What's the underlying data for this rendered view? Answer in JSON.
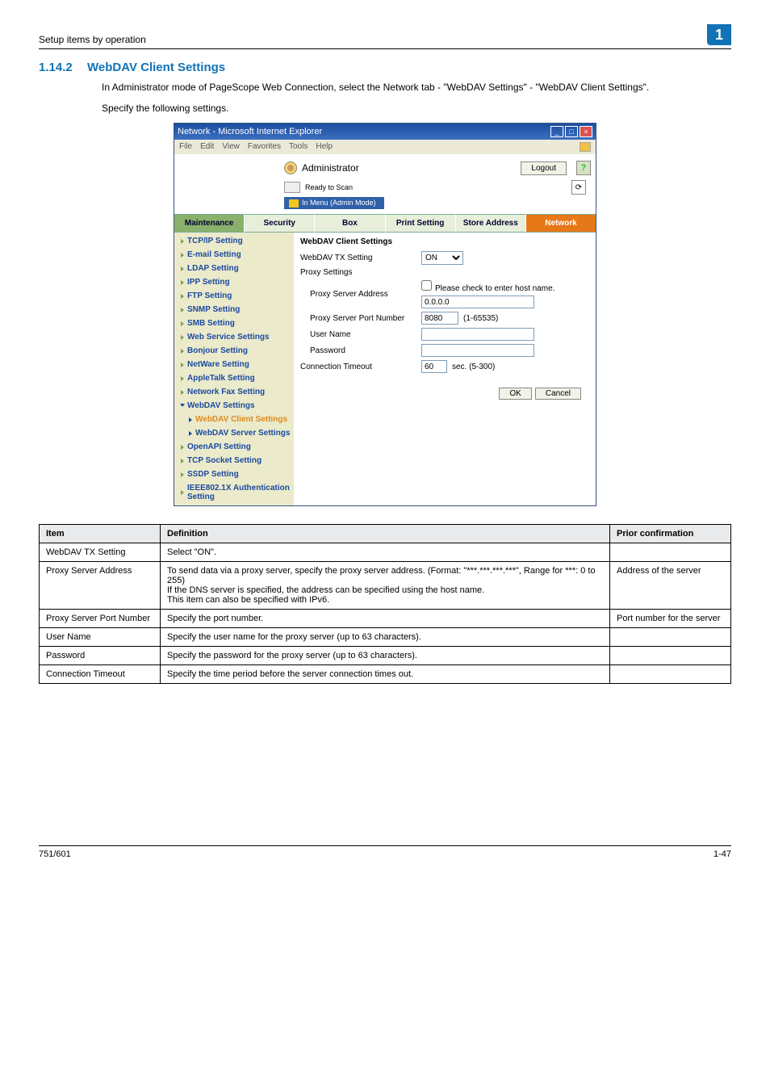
{
  "header": {
    "left": "Setup items by operation",
    "badge": "1"
  },
  "section": {
    "num": "1.14.2",
    "title": "WebDAV Client Settings",
    "p1": "In Administrator mode of PageScope Web Connection, select the Network tab - \"WebDAV Settings\" - \"WebDAV Client Settings\".",
    "p2": "Specify the following settings."
  },
  "window": {
    "title": "Network - Microsoft Internet Explorer",
    "minimize": "_",
    "restore": "□",
    "close": "×",
    "menus": [
      "File",
      "Edit",
      "View",
      "Favorites",
      "Tools",
      "Help"
    ],
    "admin_label": "Administrator",
    "logout": "Logout",
    "help": "?",
    "ready": "Ready to Scan",
    "ribbon": "In Menu (Admin Mode)",
    "refresh": "⟳",
    "tabs": {
      "maint": "Maintenance",
      "security": "Security",
      "box": "Box",
      "print": "Print Setting",
      "store": "Store Address",
      "network": "Network"
    },
    "side": {
      "items": [
        "TCP/IP Setting",
        "E-mail Setting",
        "LDAP Setting",
        "IPP Setting",
        "FTP Setting",
        "SNMP Setting",
        "SMB Setting",
        "Web Service Settings",
        "Bonjour Setting",
        "NetWare Setting",
        "AppleTalk Setting",
        "Network Fax Setting"
      ],
      "webdav_head": "WebDAV Settings",
      "webdav_client": "WebDAV Client Settings",
      "webdav_server": "WebDAV Server Settings",
      "rest": [
        "OpenAPI Setting",
        "TCP Socket Setting",
        "SSDP Setting",
        "IEEE802.1X Authentication Setting"
      ]
    },
    "form": {
      "heading": "WebDAV Client Settings",
      "tx_label": "WebDAV TX Setting",
      "tx_value": "ON",
      "proxy_section": "Proxy Settings",
      "addr_label": "Proxy Server Address",
      "addr_check": "Please check to enter host name.",
      "addr_value": "0.0.0.0",
      "port_label": "Proxy Server Port Number",
      "port_value": "8080",
      "port_range": "(1-65535)",
      "user_label": "User Name",
      "pass_label": "Password",
      "timeout_label": "Connection Timeout",
      "timeout_value": "60",
      "timeout_unit": "sec. (5-300)",
      "ok": "OK",
      "cancel": "Cancel"
    }
  },
  "table": {
    "head": {
      "item": "Item",
      "def": "Definition",
      "prior": "Prior confirmation"
    },
    "rows": [
      {
        "item": "WebDAV TX Setting",
        "def": "Select \"ON\".",
        "prior": ""
      },
      {
        "item": "Proxy Server Address",
        "def": "To send data via a proxy server, specify the proxy server address. (Format: \"***.***.***.***\", Range for ***: 0 to 255)\nIf the DNS server is specified, the address can be specified using the host name.\nThis item can also be specified with IPv6.",
        "prior": "Address of the server"
      },
      {
        "item": "Proxy Server Port Number",
        "def": "Specify the port number.",
        "prior": "Port number for the server"
      },
      {
        "item": "User Name",
        "def": "Specify the user name for the proxy server (up to 63 characters).",
        "prior": ""
      },
      {
        "item": "Password",
        "def": "Specify the password for the proxy server (up to 63 characters).",
        "prior": ""
      },
      {
        "item": "Connection Timeout",
        "def": "Specify the time period before the server connection times out.",
        "prior": ""
      }
    ]
  },
  "footer": {
    "left": "751/601",
    "right": "1-47"
  }
}
